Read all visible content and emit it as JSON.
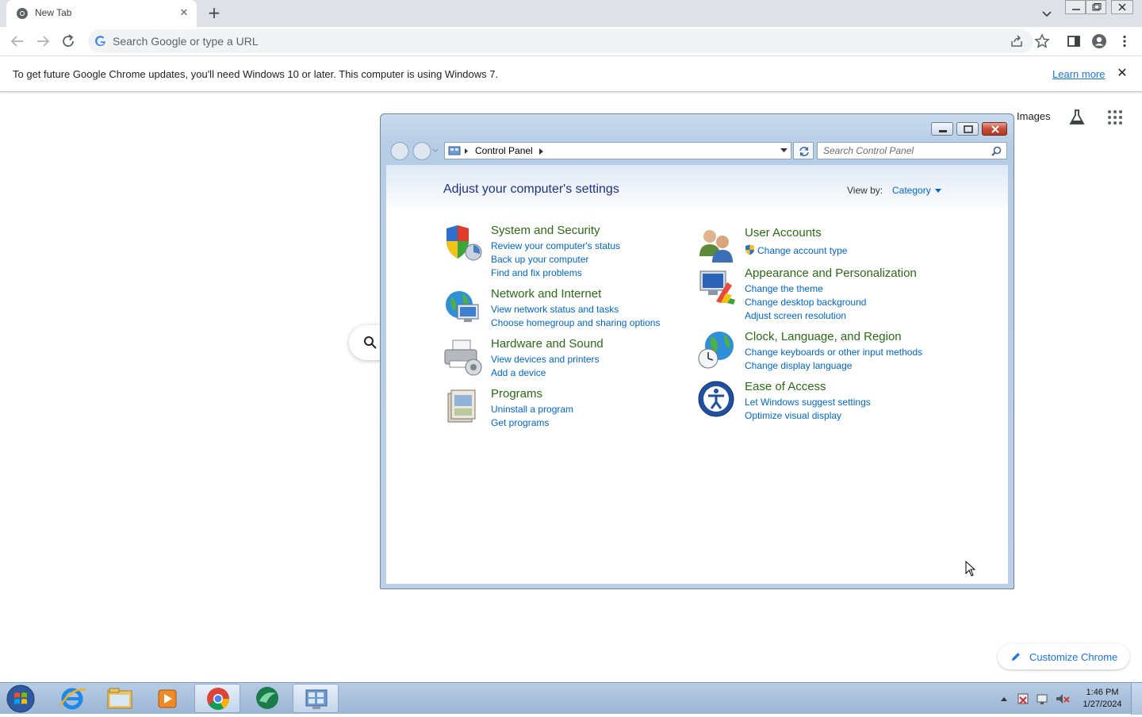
{
  "browser": {
    "tab": {
      "title": "New Tab",
      "close": "✕"
    },
    "new_tab": "+",
    "omnibox": {
      "placeholder": "Search Google or type a URL"
    },
    "infobar": {
      "message": "To get future Google Chrome updates, you'll need Windows 10 or later. This computer is using Windows 7.",
      "learn_more": "Learn more",
      "close": "✕"
    }
  },
  "ntp": {
    "images_link": "Images",
    "customize": "Customize Chrome"
  },
  "control_panel": {
    "breadcrumb": "Control Panel",
    "search_placeholder": "Search Control Panel",
    "heading": "Adjust your computer's settings",
    "view_by_label": "View by:",
    "view_by_value": "Category",
    "categories_left": [
      {
        "title": "System and Security",
        "icon": "shield-icon",
        "links": [
          "Review your computer's status",
          "Back up your computer",
          "Find and fix problems"
        ]
      },
      {
        "title": "Network and Internet",
        "icon": "network-globe-icon",
        "links": [
          "View network status and tasks",
          "Choose homegroup and sharing options"
        ]
      },
      {
        "title": "Hardware and Sound",
        "icon": "printer-icon",
        "links": [
          "View devices and printers",
          "Add a device"
        ]
      },
      {
        "title": "Programs",
        "icon": "programs-icon",
        "links": [
          "Uninstall a program",
          "Get programs"
        ]
      }
    ],
    "categories_right": [
      {
        "title": "User Accounts",
        "icon": "users-icon",
        "links": [
          "Change account type"
        ]
      },
      {
        "title": "Appearance and Personalization",
        "icon": "monitor-paint-icon",
        "links": [
          "Change the theme",
          "Change desktop background",
          "Adjust screen resolution"
        ]
      },
      {
        "title": "Clock, Language, and Region",
        "icon": "globe-clock-icon",
        "links": [
          "Change keyboards or other input methods",
          "Change display language"
        ]
      },
      {
        "title": "Ease of Access",
        "icon": "ease-of-access-icon",
        "links": [
          "Let Windows suggest settings",
          "Optimize visual display"
        ]
      }
    ]
  },
  "taskbar": {
    "time": "1:46 PM",
    "date": "1/27/2024",
    "apps": [
      "internet-explorer-icon",
      "file-explorer-icon",
      "media-player-icon",
      "chrome-icon",
      "app-icon",
      "control-panel-icon"
    ]
  },
  "colors": {
    "chrome_blue": "#1a73e8",
    "cp_link": "#0066cc",
    "cp_category": "#2a6a14",
    "cp_heading": "#1e3287"
  }
}
